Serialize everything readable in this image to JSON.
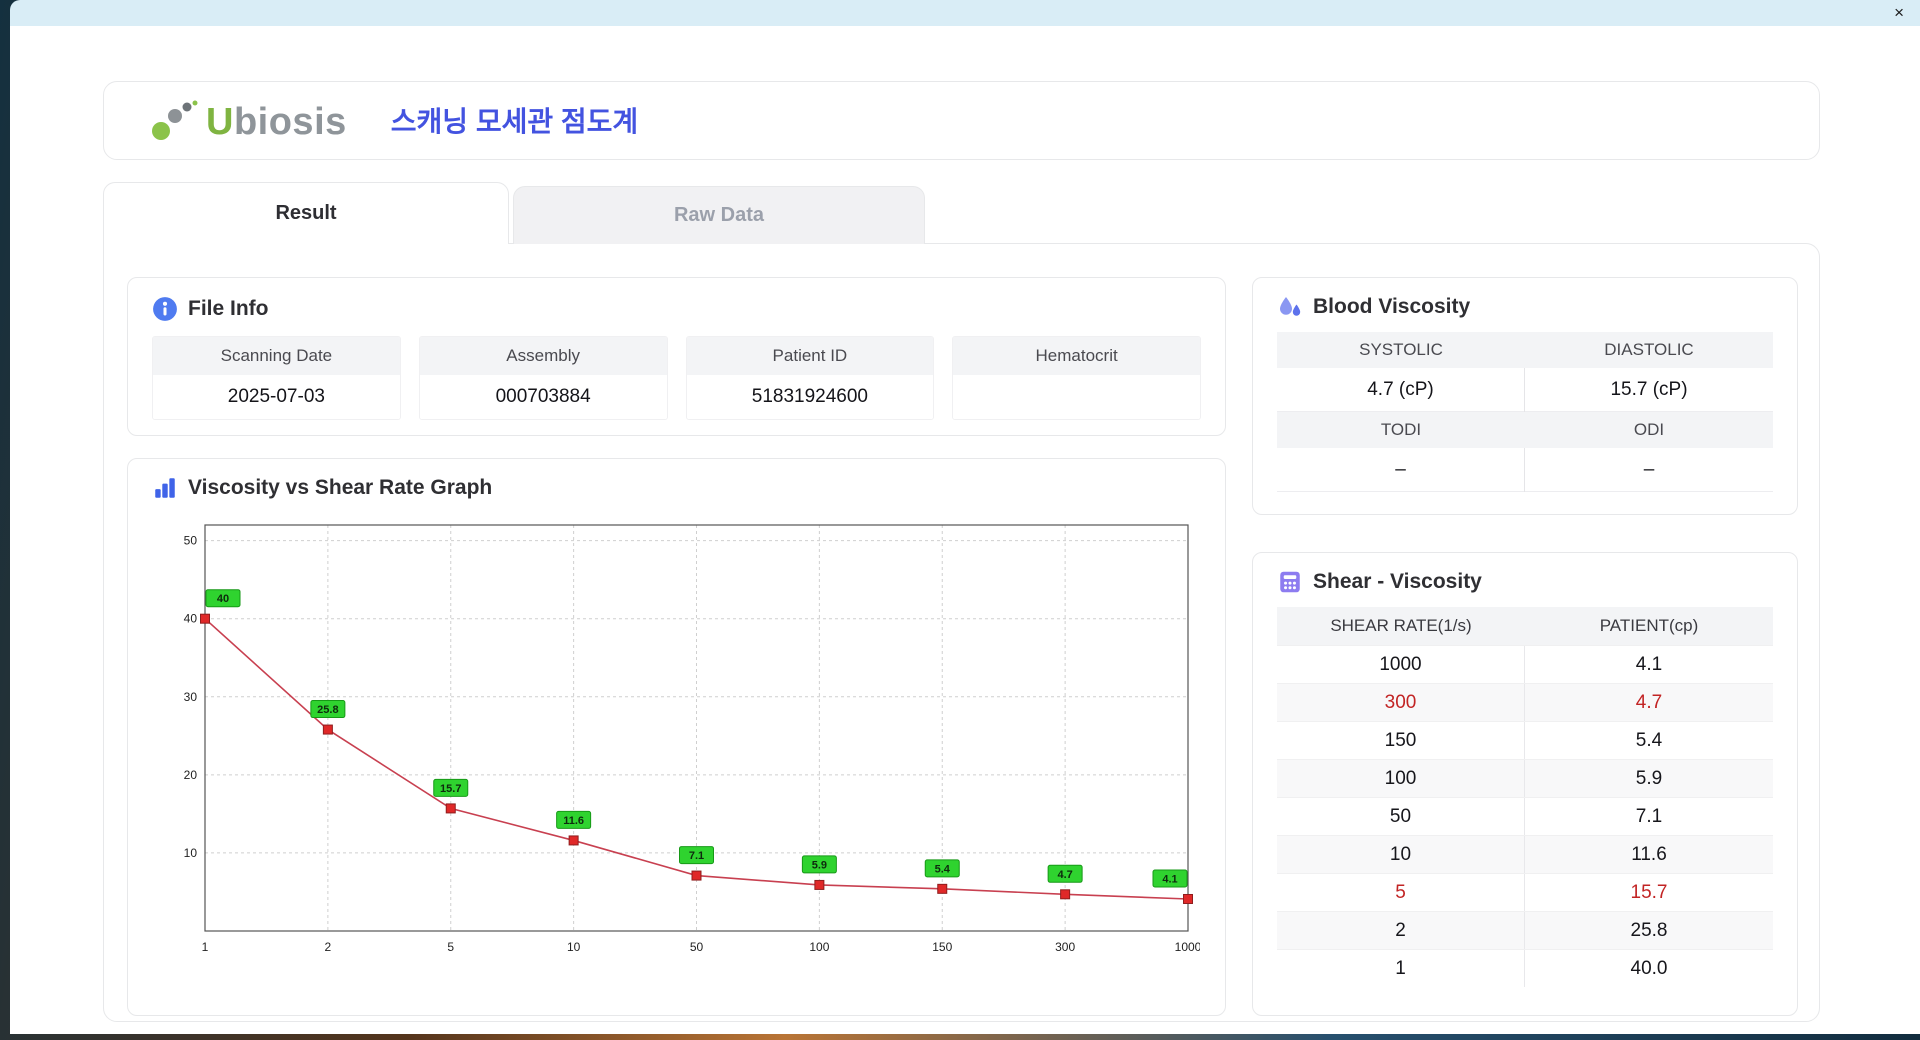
{
  "window": {
    "close_label": "×"
  },
  "header": {
    "logo_text": "Ubiosis",
    "title": "스캐닝 모세관 점도계"
  },
  "tabs": [
    {
      "label": "Result",
      "active": true
    },
    {
      "label": "Raw Data",
      "active": false
    }
  ],
  "file_info": {
    "title": "File Info",
    "fields": [
      {
        "label": "Scanning Date",
        "value": "2025-07-03"
      },
      {
        "label": "Assembly",
        "value": "000703884"
      },
      {
        "label": "Patient ID",
        "value": "51831924600"
      },
      {
        "label": "Hematocrit",
        "value": ""
      }
    ]
  },
  "blood_viscosity": {
    "title": "Blood Viscosity",
    "rows": [
      {
        "labels": [
          "SYSTOLIC",
          "DIASTOLIC"
        ],
        "values": [
          "4.7 (cP)",
          "15.7 (cP)"
        ]
      },
      {
        "labels": [
          "TODI",
          "ODI"
        ],
        "values": [
          "–",
          "–"
        ]
      }
    ]
  },
  "chart_data": {
    "type": "line",
    "title": "Viscosity vs Shear Rate Graph",
    "x_scale": "categorical",
    "categories": [
      "1",
      "2",
      "5",
      "10",
      "50",
      "100",
      "150",
      "300",
      "1000"
    ],
    "values": [
      40,
      25.8,
      15.7,
      11.6,
      7.1,
      5.9,
      5.4,
      4.7,
      4.1
    ],
    "point_labels": [
      "40",
      "25.8",
      "15.7",
      "11.6",
      "7.1",
      "5.9",
      "5.4",
      "4.7",
      "4.1"
    ],
    "xlabel": "",
    "ylabel": "",
    "yticks": [
      10,
      20,
      30,
      40,
      50
    ],
    "ylim": [
      0,
      52
    ],
    "grid": true,
    "legend": "none",
    "line_color": "#c84050",
    "marker_color": "#e02828",
    "marker_border": "#8f1d1d",
    "label_bg": "#2fd32f",
    "label_border": "#179917"
  },
  "shear_viscosity": {
    "title": "Shear - Viscosity",
    "columns": [
      "SHEAR RATE(1/s)",
      "PATIENT(cp)"
    ],
    "rows": [
      {
        "shear": "1000",
        "patient": "4.1",
        "highlight": false
      },
      {
        "shear": "300",
        "patient": "4.7",
        "highlight": true
      },
      {
        "shear": "150",
        "patient": "5.4",
        "highlight": false
      },
      {
        "shear": "100",
        "patient": "5.9",
        "highlight": false
      },
      {
        "shear": "50",
        "patient": "7.1",
        "highlight": false
      },
      {
        "shear": "10",
        "patient": "11.6",
        "highlight": false
      },
      {
        "shear": "5",
        "patient": "15.7",
        "highlight": true
      },
      {
        "shear": "2",
        "patient": "25.8",
        "highlight": false
      },
      {
        "shear": "1",
        "patient": "40.0",
        "highlight": false
      }
    ]
  },
  "colors": {
    "accent_blue": "#4353e0",
    "highlight_red": "#c22424",
    "label_green": "#2fd32f",
    "titlebar": "#d9edf6"
  }
}
